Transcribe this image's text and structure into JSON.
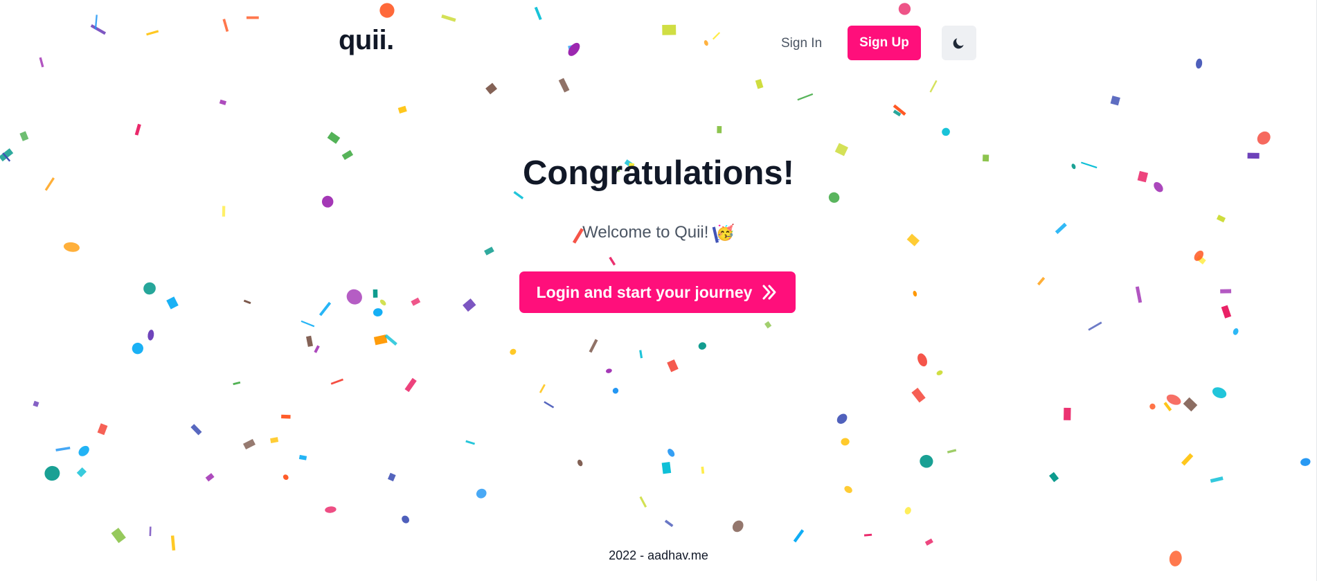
{
  "header": {
    "logo": "quii.",
    "sign_in_label": "Sign In",
    "sign_up_label": "Sign Up",
    "theme_toggle_icon": "moon-icon"
  },
  "main": {
    "title": "Congratulations!",
    "subtitle": "Welcome to Quii!",
    "subtitle_emoji": "🥳",
    "cta_label": "Login and start your journey",
    "cta_icon": "double-chevron-right-icon"
  },
  "footer": {
    "text": "2022 - aadhav.me"
  },
  "colors": {
    "accent": "#ff0f7b",
    "toggle_bg": "#eef0f3",
    "heading": "#111827",
    "muted": "#4b5563",
    "confetti": [
      "#e91e63",
      "#9c27b0",
      "#673ab7",
      "#3f51b5",
      "#2196f3",
      "#03a9f4",
      "#00bcd4",
      "#009688",
      "#4caf50",
      "#8bc34a",
      "#cddc39",
      "#ffeb3b",
      "#ffc107",
      "#ff9800",
      "#ff5722",
      "#795548",
      "#f44336"
    ]
  }
}
